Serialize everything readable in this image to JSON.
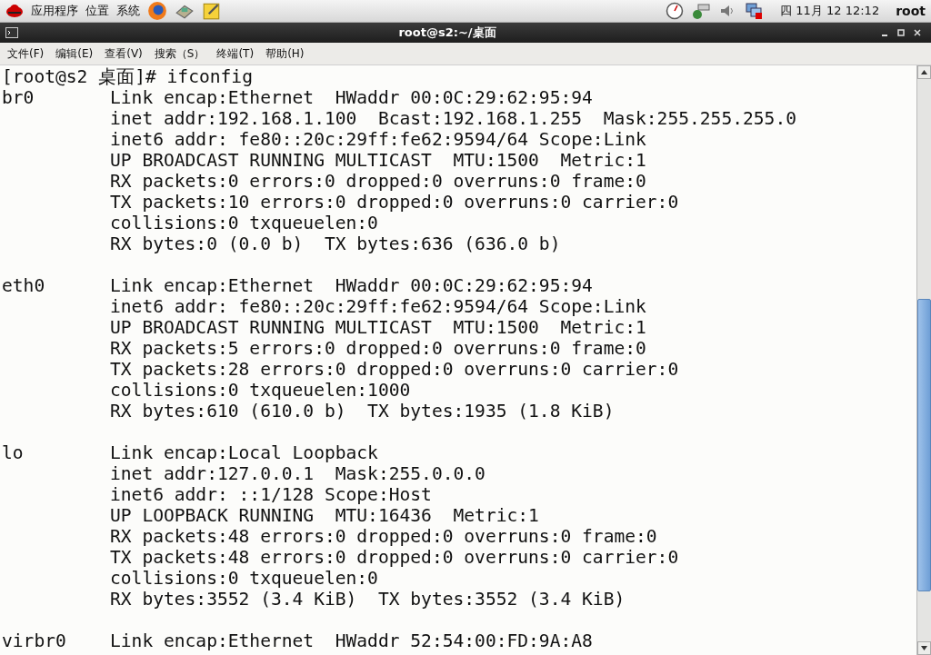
{
  "top_panel": {
    "menus": [
      "应用程序",
      "位置",
      "系统"
    ],
    "clock": "四 11月 12 12:12",
    "user": "root"
  },
  "window": {
    "title": "root@s2:~/桌面"
  },
  "menu_bar": [
    "文件(F)",
    "编辑(E)",
    "查看(V)",
    "搜索（S）",
    "终端(T)",
    "帮助(H)"
  ],
  "terminal": {
    "prompt": "[root@s2 桌面]# ifconfig",
    "interfaces": [
      {
        "name": "br0",
        "lines": [
          "Link encap:Ethernet  HWaddr 00:0C:29:62:95:94",
          "inet addr:192.168.1.100  Bcast:192.168.1.255  Mask:255.255.255.0",
          "inet6 addr: fe80::20c:29ff:fe62:9594/64 Scope:Link",
          "UP BROADCAST RUNNING MULTICAST  MTU:1500  Metric:1",
          "RX packets:0 errors:0 dropped:0 overruns:0 frame:0",
          "TX packets:10 errors:0 dropped:0 overruns:0 carrier:0",
          "collisions:0 txqueuelen:0",
          "RX bytes:0 (0.0 b)  TX bytes:636 (636.0 b)"
        ]
      },
      {
        "name": "eth0",
        "lines": [
          "Link encap:Ethernet  HWaddr 00:0C:29:62:95:94",
          "inet6 addr: fe80::20c:29ff:fe62:9594/64 Scope:Link",
          "UP BROADCAST RUNNING MULTICAST  MTU:1500  Metric:1",
          "RX packets:5 errors:0 dropped:0 overruns:0 frame:0",
          "TX packets:28 errors:0 dropped:0 overruns:0 carrier:0",
          "collisions:0 txqueuelen:1000",
          "RX bytes:610 (610.0 b)  TX bytes:1935 (1.8 KiB)"
        ]
      },
      {
        "name": "lo",
        "lines": [
          "Link encap:Local Loopback",
          "inet addr:127.0.0.1  Mask:255.0.0.0",
          "inet6 addr: ::1/128 Scope:Host",
          "UP LOOPBACK RUNNING  MTU:16436  Metric:1",
          "RX packets:48 errors:0 dropped:0 overruns:0 frame:0",
          "TX packets:48 errors:0 dropped:0 overruns:0 carrier:0",
          "collisions:0 txqueuelen:0",
          "RX bytes:3552 (3.4 KiB)  TX bytes:3552 (3.4 KiB)"
        ]
      },
      {
        "name": "virbr0",
        "lines": [
          "Link encap:Ethernet  HWaddr 52:54:00:FD:9A:A8"
        ]
      }
    ]
  }
}
